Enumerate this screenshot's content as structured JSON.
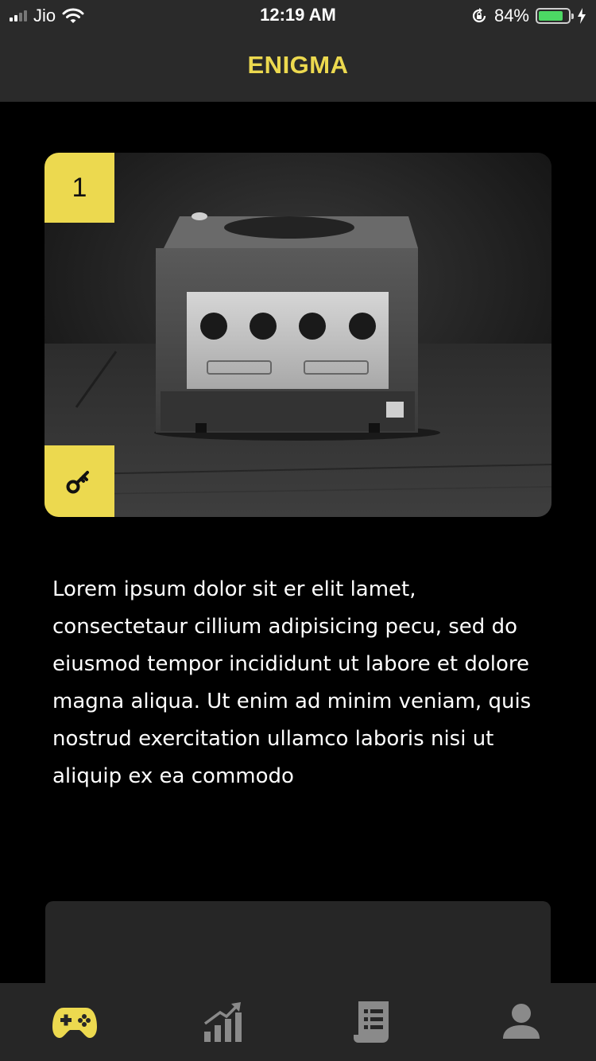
{
  "status_bar": {
    "carrier": "Jio",
    "time": "12:19 AM",
    "battery_percent": "84%",
    "battery_level": 0.84,
    "icons": [
      "signal-icon",
      "wifi-icon",
      "orientation-lock-icon",
      "battery-icon",
      "charging-icon"
    ]
  },
  "nav": {
    "title": "ENIGMA"
  },
  "card": {
    "number": "1",
    "image_icon": "game-console-photo",
    "badge_icon": "key-icon"
  },
  "description": "Lorem ipsum dolor sit er elit lamet, consectetaur cillium adipisicing pecu, sed do eiusmod tempor incididunt ut labore et dolore magna aliqua. Ut enim ad minim veniam, quis nostrud exercitation ullamco laboris nisi ut aliquip ex ea commodo",
  "tabs": [
    {
      "icon": "gamepad-icon",
      "active": true
    },
    {
      "icon": "stats-chart-icon",
      "active": false
    },
    {
      "icon": "document-list-icon",
      "active": false
    },
    {
      "icon": "profile-icon",
      "active": false
    }
  ],
  "colors": {
    "accent": "#ecd94f",
    "nav_background": "#2a2a2a",
    "background": "#000000",
    "panel": "#262626",
    "inactive_icon": "#8a8a8a",
    "charging_green": "#4cd964"
  }
}
